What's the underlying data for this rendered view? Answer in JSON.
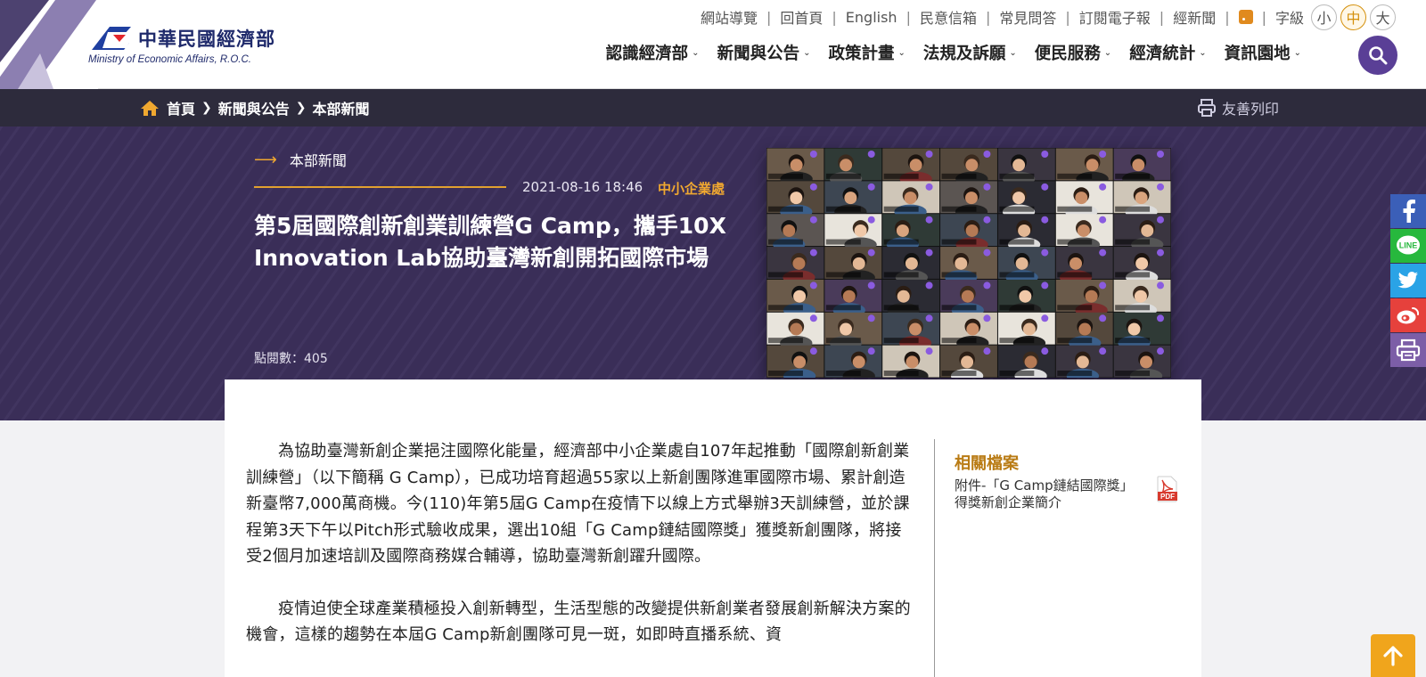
{
  "header": {
    "logo_zh": "中華民國經濟部",
    "logo_en": "Ministry of Economic Affairs, R.O.C.",
    "top_links": [
      "網站導覽",
      "回首頁",
      "English",
      "民意信箱",
      "常見問答",
      "訂閱電子報",
      "經新聞"
    ],
    "font_size_label": "字級",
    "font_sizes": [
      "小",
      "中",
      "大"
    ],
    "font_size_selected": "中",
    "main_nav": [
      "認識經濟部",
      "新聞與公告",
      "政策計畫",
      "法規及訴願",
      "便民服務",
      "經濟統計",
      "資訊園地"
    ],
    "icons": {
      "search": "search-icon",
      "rss": "rss-icon"
    }
  },
  "breadcrumb": {
    "items": [
      "首頁",
      "新聞與公告",
      "本部新聞"
    ],
    "print_label": "友善列印"
  },
  "hero": {
    "category": "本部新聞",
    "date": "2021-08-16 18:46",
    "department": "中小企業處",
    "title": "第5屆國際創新創業訓練營G Camp，攜手10X Innovation Lab協助臺灣新創開拓國際市場",
    "views": "點閱數：405"
  },
  "article": {
    "paragraphs": [
      "為協助臺灣新創企業挹注國際化能量，經濟部中小企業處自107年起推動「國際創新創業訓練營」（以下簡稱 G Camp），已成功培育超過55家以上新創團隊進軍國際市場、累計創造新臺幣7,000萬商機。今(110)年第5屆G Camp在疫情下以線上方式舉辦3天訓練營，並於課程第3天下午以Pitch形式驗收成果，選出10組「G Camp鏈結國際獎」獲獎新創團隊，將接受2個月加速培訓及國際商務媒合輔導，協助臺灣新創躍升國際。",
      "疫情迫使全球產業積極投入創新轉型，生活型態的改變提供新創業者發展創新解決方案的機會，這樣的趨勢在本屆G Camp新創團隊可見一斑，如即時直播系統、資"
    ]
  },
  "related": {
    "title": "相關檔案",
    "file_label": "附件-「G Camp鏈結國際獎」得獎新創企業簡介",
    "file_type": "PDF"
  },
  "social": [
    "facebook-icon",
    "line-icon",
    "twitter-icon",
    "weibo-icon",
    "print-icon"
  ],
  "social_text": {
    "line": "LINE"
  },
  "colors": {
    "purple": "#3b2f5a",
    "accent": "#f0a830",
    "dark_bar": "#2d2b3c",
    "search": "#5a3f96"
  }
}
